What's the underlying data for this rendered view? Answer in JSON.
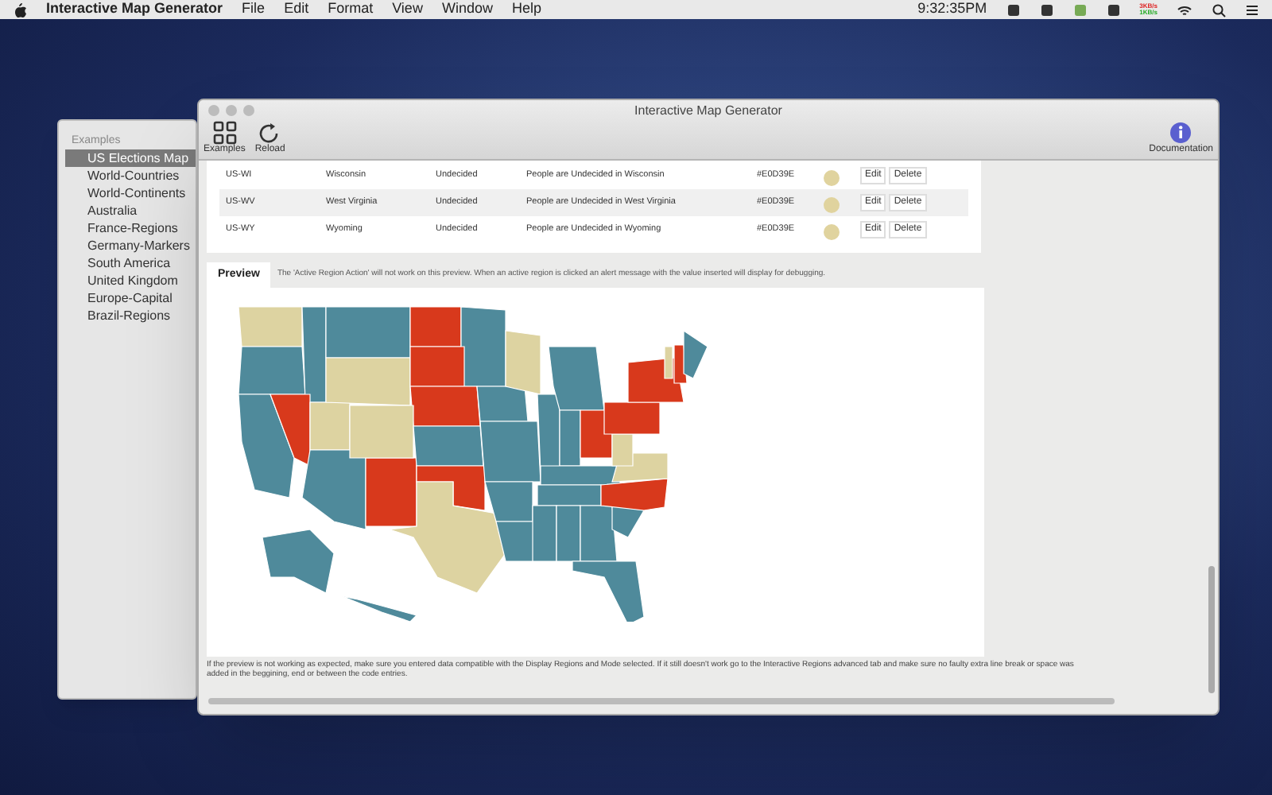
{
  "menubar": {
    "app_name": "Interactive Map Generator",
    "menus": [
      "File",
      "Edit",
      "Format",
      "View",
      "Window",
      "Help"
    ],
    "time": "9:32:35PM",
    "net_up": "3KB/s",
    "net_down": "1KB/s"
  },
  "examples_window": {
    "header": "Examples",
    "items": [
      {
        "label": "US Elections Map",
        "selected": true
      },
      {
        "label": "World-Countries",
        "selected": false
      },
      {
        "label": "World-Continents",
        "selected": false
      },
      {
        "label": "Australia",
        "selected": false
      },
      {
        "label": "France-Regions",
        "selected": false
      },
      {
        "label": "Germany-Markers",
        "selected": false
      },
      {
        "label": "South America",
        "selected": false
      },
      {
        "label": "United Kingdom",
        "selected": false
      },
      {
        "label": "Europe-Capital",
        "selected": false
      },
      {
        "label": "Brazil-Regions",
        "selected": false
      }
    ]
  },
  "window": {
    "title": "Interactive Map Generator",
    "toolbar": [
      {
        "kind": "grid",
        "label": "Examples"
      },
      {
        "kind": "reload",
        "label": "Reload"
      }
    ],
    "toolbar_right": {
      "kind": "info",
      "label": "Documentation"
    }
  },
  "table": {
    "rows": [
      {
        "code": "US-WI",
        "name": "Wisconsin",
        "status": "Undecided",
        "tooltip": "People are Undecided in Wisconsin",
        "hex": "#E0D39E",
        "color": "#e0d39e",
        "edit": "Edit",
        "delete": "Delete"
      },
      {
        "code": "US-WV",
        "name": "West Virginia",
        "status": "Undecided",
        "tooltip": "People are Undecided in West Virginia",
        "hex": "#E0D39E",
        "color": "#e0d39e",
        "edit": "Edit",
        "delete": "Delete"
      },
      {
        "code": "US-WY",
        "name": "Wyoming",
        "status": "Undecided",
        "tooltip": "People are Undecided in Wyoming",
        "hex": "#E0D39E",
        "color": "#e0d39e",
        "edit": "Edit",
        "delete": "Delete"
      }
    ]
  },
  "preview": {
    "tab": {
      "label": "Preview",
      "selected": true
    },
    "note": "The 'Active Region Action' will not work on this preview. When an active region is clicked an alert message with the value inserted will display for debugging.",
    "footer": "If the preview is not working as expected, make sure you entered data compatible with the Display Regions and Mode selected. If it still doesn't work go to the Interactive Regions advanced tab and make sure no faulty extra line break or space was added in the beggining, end or between the code entries."
  }
}
